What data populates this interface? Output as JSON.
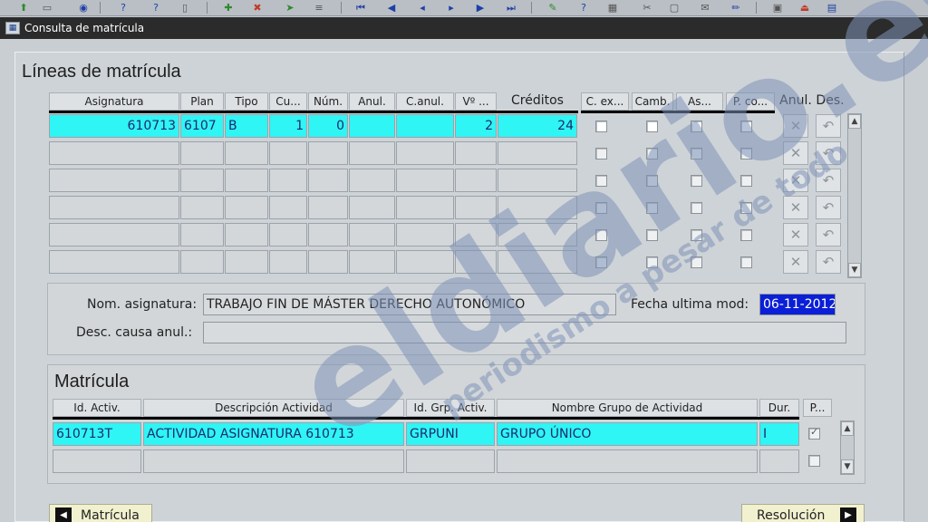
{
  "window": {
    "title": "Consulta de matrícula"
  },
  "toolbar": {
    "icons": [
      "save-icon",
      "print-icon",
      "help-icon",
      "query-icon",
      "insert-record-icon",
      "delete-record-icon",
      "navigate-icon",
      "first-icon",
      "previous-icon",
      "next-icon",
      "last-icon",
      "edit-icon",
      "info-icon",
      "exit-icon"
    ]
  },
  "lineas": {
    "title": "Líneas de matrícula",
    "headers": {
      "asignatura": "Asignatura",
      "plan": "Plan",
      "tipo": "Tipo",
      "cu": "Cu...",
      "num": "Núm.",
      "anul": "Anul.",
      "canul": "C.anul.",
      "v": "Vº ...",
      "creditos": "Créditos",
      "cex": "C. ex...",
      "camb": "Camb.",
      "as": "As...",
      "pco": "P. co...",
      "anul_btn": "Anul.",
      "des_btn": "Des."
    },
    "rows": [
      {
        "asignatura": "610713",
        "plan": "6107",
        "tipo": "B",
        "cu": "1",
        "num": "0",
        "anul": "",
        "canul": "",
        "v": "2",
        "creditos": "24"
      },
      {
        "asignatura": "",
        "plan": "",
        "tipo": "",
        "cu": "",
        "num": "",
        "anul": "",
        "canul": "",
        "v": "",
        "creditos": ""
      },
      {
        "asignatura": "",
        "plan": "",
        "tipo": "",
        "cu": "",
        "num": "",
        "anul": "",
        "canul": "",
        "v": "",
        "creditos": ""
      },
      {
        "asignatura": "",
        "plan": "",
        "tipo": "",
        "cu": "",
        "num": "",
        "anul": "",
        "canul": "",
        "v": "",
        "creditos": ""
      },
      {
        "asignatura": "",
        "plan": "",
        "tipo": "",
        "cu": "",
        "num": "",
        "anul": "",
        "canul": "",
        "v": "",
        "creditos": ""
      },
      {
        "asignatura": "",
        "plan": "",
        "tipo": "",
        "cu": "",
        "num": "",
        "anul": "",
        "canul": "",
        "v": "",
        "creditos": ""
      }
    ],
    "anular_glyph": "✕",
    "deshacer_glyph": "↶"
  },
  "detalle": {
    "nom_label": "Nom. asignatura:",
    "nom_value": "TRABAJO FIN DE MÁSTER DERECHO AUTONÓMICO",
    "fecha_label": "Fecha ultima mod:",
    "fecha_value": "06-11-2012",
    "desc_label": "Desc. causa anul.:",
    "desc_value": ""
  },
  "matricula": {
    "title": "Matrícula",
    "headers": {
      "id_activ": "Id. Activ.",
      "descripcion": "Descripción Actividad",
      "id_grp": "Id. Grp. Activ.",
      "nombre_grupo": "Nombre Grupo de Actividad",
      "dur": "Dur.",
      "p": "P..."
    },
    "rows": [
      {
        "id_activ": "610713T",
        "descripcion": "ACTIVIDAD ASIGNATURA 610713",
        "id_grp": "GRPUNI",
        "nombre_grupo": "GRUPO ÚNICO",
        "dur": "I"
      },
      {
        "id_activ": "",
        "descripcion": "",
        "id_grp": "",
        "nombre_grupo": "",
        "dur": ""
      }
    ]
  },
  "nav": {
    "matricula_label": "Matrícula",
    "resolucion_label": "Resolución",
    "left_glyph": "◀",
    "right_glyph": "▶"
  },
  "watermark": {
    "brand": "eldiario.es",
    "tagline": "periodismo a pesar de todo",
    "color": "#7f93b8"
  },
  "colors": {
    "active_row": "#2ff5f5",
    "selected_field": "#0a1fd6"
  }
}
